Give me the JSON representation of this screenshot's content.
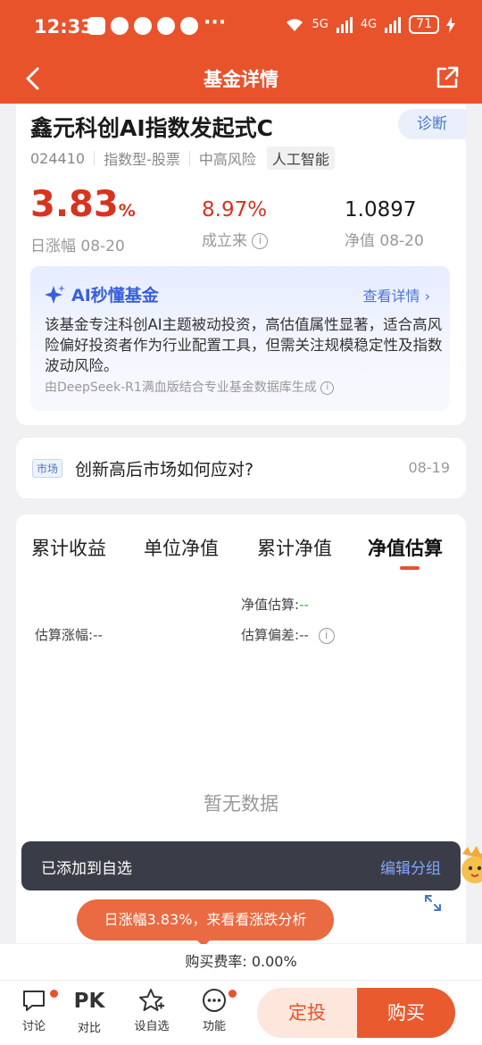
{
  "status_bar": {
    "time": "12:33",
    "ellipsis": "···",
    "signal_1": "5G",
    "signal_2": "4G",
    "battery": "71"
  },
  "nav": {
    "title": "基金详情"
  },
  "fund": {
    "name": "鑫元科创AI指数发起式C",
    "diagnose_label": "诊断",
    "code": "024410",
    "type": "指数型-股票",
    "risk": "中高风险",
    "theme": "人工智能",
    "daily_change_value": "3.83",
    "daily_change_unit": "%",
    "daily_change_label": "日涨幅 08-20",
    "since_inception_value": "8.97%",
    "since_inception_label": "成立来",
    "nav_value": "1.0897",
    "nav_label": "净值 08-20"
  },
  "ai_summary": {
    "title": "AI秒懂基金",
    "more_label": "查看详情",
    "text": "该基金专注科创AI主题被动投资，高估值属性显著，适合高风险偏好投资者作为行业配置工具，但需关注规模稳定性及指数波动风险。",
    "source": "由DeepSeek-R1满血版结合专业基金数据库生成"
  },
  "news": {
    "tag": "市场",
    "title": "创新高后市场如何应对?",
    "date": "08-19"
  },
  "chart_tabs": [
    {
      "label": "累计收益"
    },
    {
      "label": "单位净值"
    },
    {
      "label": "累计净值"
    },
    {
      "label": "净值估算"
    }
  ],
  "estimate": {
    "nav_est_label": "净值估算:",
    "nav_est_value": "--",
    "change_label": "估算涨幅:",
    "change_value": "--",
    "deviation_label": "估算偏差:",
    "deviation_value": "--",
    "no_data": "暂无数据"
  },
  "toast": {
    "message": "已添加到自选",
    "action": "编辑分组"
  },
  "bubble": {
    "text": "日涨幅3.83%，来看看涨跌分析"
  },
  "fee": {
    "text": "购买费率: 0.00%"
  },
  "bottom_bar": {
    "discuss": "讨论",
    "pk_glyph": "PK",
    "compare": "对比",
    "add_watch": "设自选",
    "functions": "功能",
    "fixed_invest": "定投",
    "buy": "购买"
  },
  "colors": {
    "brand": "#e8532c",
    "rise": "#d8331f",
    "ai_blue": "#3a5fd8"
  }
}
